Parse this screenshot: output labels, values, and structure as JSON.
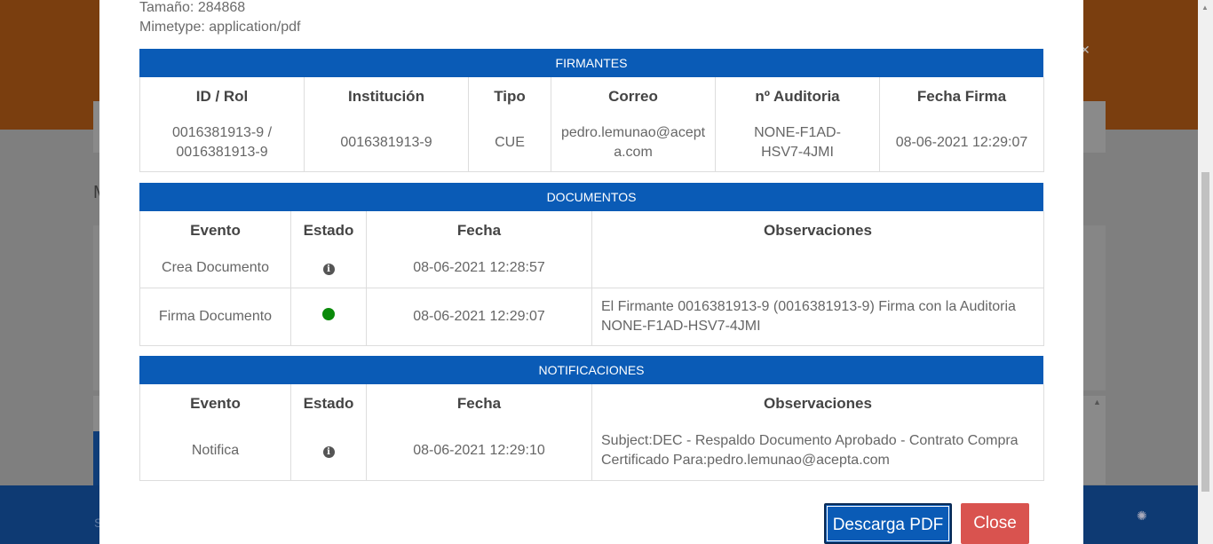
{
  "meta": {
    "size": "Tamaño: 284868",
    "mimetype": "Mimetype: application/pdf"
  },
  "firmantes": {
    "title": "FIRMANTES",
    "headers": [
      "ID / Rol",
      "Institución",
      "Tipo",
      "Correo",
      "nº Auditoria",
      "Fecha Firma"
    ],
    "rows": [
      {
        "id_rol": "0016381913-9 / 0016381913-9",
        "institucion": "0016381913-9",
        "tipo": "CUE",
        "correo": "pedro.lemunao@acepta.com",
        "auditoria": "NONE-F1AD-HSV7-4JMI",
        "fecha": "08-06-2021 12:29:07"
      }
    ]
  },
  "documentos": {
    "title": "DOCUMENTOS",
    "headers": [
      "Evento",
      "Estado",
      "Fecha",
      "Observaciones"
    ],
    "rows": [
      {
        "evento": "Crea Documento",
        "estado_icon": "info-icon",
        "fecha": "08-06-2021 12:28:57",
        "obs": ""
      },
      {
        "evento": "Firma Documento",
        "estado_icon": "green-dot-icon",
        "fecha": "08-06-2021 12:29:07",
        "obs": "El Firmante 0016381913-9 (0016381913-9) Firma con la Auditoria NONE-F1AD-HSV7-4JMI"
      }
    ]
  },
  "notificaciones": {
    "title": "NOTIFICACIONES",
    "headers": [
      "Evento",
      "Estado",
      "Fecha",
      "Observaciones"
    ],
    "rows": [
      {
        "evento": "Notifica",
        "estado_icon": "info-icon",
        "fecha": "08-06-2021 12:29:10",
        "obs": "Subject:DEC - Respaldo Documento Aprobado - Contrato Compra Certificado Para:pedro.lemunao@acepta.com"
      }
    ]
  },
  "buttons": {
    "download": "Descarga PDF",
    "close": "Close"
  },
  "colors": {
    "header_blue": "#0a5bb6",
    "close_red": "#d9534f",
    "status_green": "#0a8a0a"
  }
}
